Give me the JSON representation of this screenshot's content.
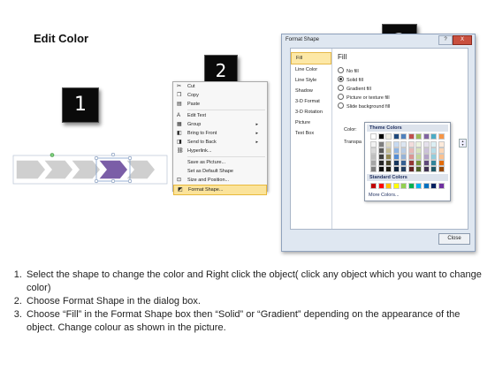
{
  "title": "Edit Color",
  "steps_badges": [
    "1",
    "2",
    "3"
  ],
  "context_menu": {
    "items": [
      {
        "label": "Cut",
        "icon": "scissors-icon",
        "submenu": false
      },
      {
        "label": "Copy",
        "icon": "copy-icon",
        "submenu": false
      },
      {
        "label": "Paste",
        "icon": "paste-icon",
        "submenu": false
      },
      {
        "label": "Edit Text",
        "icon": "edit-text-icon",
        "submenu": false
      },
      {
        "label": "Group",
        "icon": "group-icon",
        "submenu": true
      },
      {
        "label": "Bring to Front",
        "icon": "bring-front-icon",
        "submenu": true
      },
      {
        "label": "Send to Back",
        "icon": "send-back-icon",
        "submenu": true
      },
      {
        "label": "Hyperlink...",
        "icon": "hyperlink-icon",
        "submenu": false
      },
      {
        "label": "Save as Picture...",
        "icon": "",
        "submenu": false
      },
      {
        "label": "Set as Default Shape",
        "icon": "",
        "submenu": false
      },
      {
        "label": "Size and Position...",
        "icon": "size-icon",
        "submenu": false
      },
      {
        "label": "Format Shape...",
        "icon": "format-shape-icon",
        "submenu": false,
        "highlighted": true
      }
    ]
  },
  "dialog": {
    "title": "Format Shape",
    "help": "?",
    "close_x": "X",
    "sidebar": [
      "Fill",
      "Line Color",
      "Line Style",
      "Shadow",
      "3-D Format",
      "3-D Rotation",
      "Picture",
      "Text Box"
    ],
    "active_sidebar": "Fill",
    "section_heading": "Fill",
    "fill_options": [
      {
        "label": "No fill",
        "selected": false
      },
      {
        "label": "Solid fill",
        "selected": true
      },
      {
        "label": "Gradient fill",
        "selected": false
      },
      {
        "label": "Picture or texture fill",
        "selected": false
      },
      {
        "label": "Slide background fill",
        "selected": false
      }
    ],
    "color_label": "Color:",
    "transparency_label": "Transpa",
    "close_button": "Close"
  },
  "palette": {
    "theme_heading": "Theme Colors",
    "standard_heading": "Standard Colors",
    "more_colors": "More Colors...",
    "theme_top": [
      "#ffffff",
      "#000000",
      "#eeece1",
      "#1f497d",
      "#4f81bd",
      "#c0504d",
      "#9bbb59",
      "#8064a2",
      "#4bacc6",
      "#f79646"
    ],
    "theme_shades": [
      [
        "#f2f2f2",
        "#7f7f7f",
        "#ddd9c3",
        "#c6d9f0",
        "#dbe5f1",
        "#f2dcdb",
        "#ebf1dd",
        "#e5e0ec",
        "#dbeef3",
        "#fdeada"
      ],
      [
        "#d8d8d8",
        "#595959",
        "#c4bd97",
        "#8db3e2",
        "#b8cce4",
        "#e5b9b7",
        "#d7e3bc",
        "#ccc1d9",
        "#b7dde8",
        "#fbd5b5"
      ],
      [
        "#bfbfbf",
        "#3f3f3f",
        "#938953",
        "#548dd4",
        "#95b3d7",
        "#d99694",
        "#c3d69b",
        "#b2a2c7",
        "#92cddc",
        "#fac08f"
      ],
      [
        "#a5a5a5",
        "#262626",
        "#494429",
        "#17365d",
        "#366092",
        "#953734",
        "#76923c",
        "#5f497a",
        "#31859b",
        "#e36c09"
      ],
      [
        "#7f7f7f",
        "#0c0c0c",
        "#1d1b10",
        "#0f243e",
        "#244061",
        "#632423",
        "#4f6128",
        "#3f3151",
        "#205867",
        "#974806"
      ]
    ],
    "standard": [
      "#c00000",
      "#ff0000",
      "#ffc000",
      "#ffff00",
      "#92d050",
      "#00b050",
      "#00b0f0",
      "#0070c0",
      "#002060",
      "#7030a0"
    ]
  },
  "chevrons": {
    "count": 5,
    "base_color": "#cfcfcf",
    "selected_index": 3,
    "selected_color": "#7b5ea7"
  },
  "instructions": [
    "Select the shape to change the color and Right click the object( click any object which you want to change color)",
    "Choose Format Shape in the dialog box.",
    "Choose “Fill” in the Format Shape box then “Solid” or “Gradient” depending on the appearance of the object. Change colour as shown in the picture."
  ]
}
